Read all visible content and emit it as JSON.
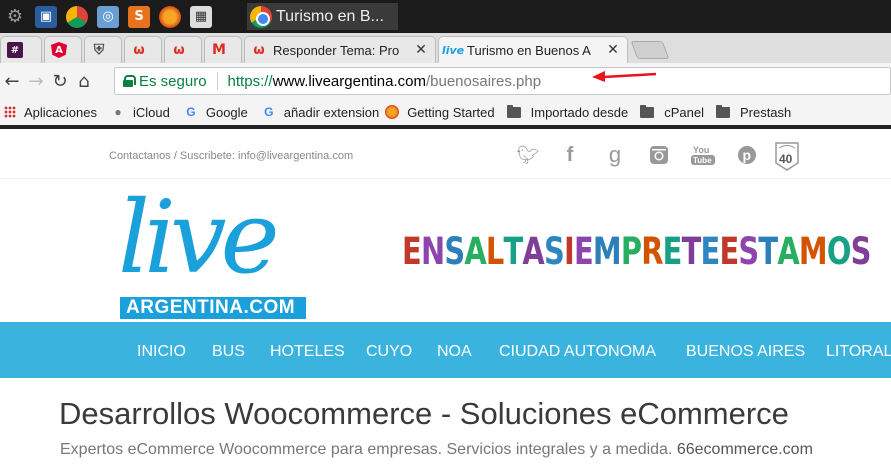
{
  "taskbar": {
    "active_window_title": "Turismo en B..."
  },
  "tabs": [
    {
      "title": ""
    },
    {
      "title": ""
    },
    {
      "title": ""
    },
    {
      "title": ""
    },
    {
      "title": ""
    },
    {
      "title": ""
    },
    {
      "title": "Responder Tema: Pro"
    },
    {
      "title": "Turismo en Buenos A"
    }
  ],
  "address_bar": {
    "security_label": "Es seguro",
    "scheme": "https://",
    "host": "www.liveargentina.com",
    "path": "/buenosaires.php"
  },
  "bookmarks": [
    {
      "label": "Aplicaciones",
      "icon": "apps-grid-icon"
    },
    {
      "label": "iCloud",
      "icon": "apple-icon"
    },
    {
      "label": "Google",
      "icon": "google-icon"
    },
    {
      "label": "añadir extension",
      "icon": "google-icon"
    },
    {
      "label": "Getting Started",
      "icon": "firefox-icon"
    },
    {
      "label": "Importado desde",
      "icon": "folder-icon"
    },
    {
      "label": "cPanel",
      "icon": "folder-icon"
    },
    {
      "label": "Prestash",
      "icon": "folder-icon"
    }
  ],
  "site": {
    "contact_text": "Contactanos / Suscribete: info@liveargentina.com",
    "logo_word": "live",
    "logo_sub": "ARGENTINA.COM",
    "badge_number": "40",
    "banner_text": "EN SALTA SIEMPRE TE ESTAMOS",
    "nav_items": [
      "INICIO",
      "BUS",
      "HOTELES",
      "CUYO",
      "NOA",
      "CIUDAD AUTONOMA",
      "BUENOS AIRES",
      "LITORAL"
    ]
  },
  "ad": {
    "title": "Desarrollos Woocommerce - Soluciones eCommerce",
    "subtitle": "Expertos eCommerce Woocommerce para empresas. Servicios integrales y a medida.",
    "domain": "66ecommerce.com"
  },
  "colors": {
    "nav_bg": "#3ab4df",
    "logo_blue": "#1aa0db",
    "secure_green": "#0b8043"
  }
}
